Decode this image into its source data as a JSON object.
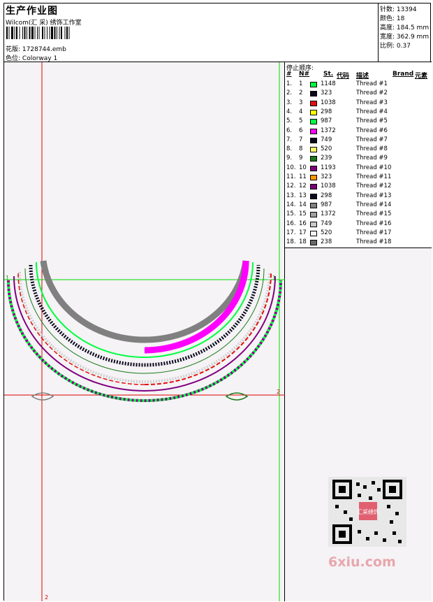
{
  "header": {
    "title": "生产作业图",
    "company": "Wilcom(汇 采) 绣饰工作室",
    "design_label": "花版:",
    "design_value": "1728744.emb",
    "colorway_label": "色位:",
    "colorway_value": "Colorway 1"
  },
  "specs": [
    {
      "label": "针数:",
      "value": "13394"
    },
    {
      "label": "颜色:",
      "value": "18"
    },
    {
      "label": "高度:",
      "value": "184.5 mm"
    },
    {
      "label": "宽度:",
      "value": "362.9 mm"
    },
    {
      "label": "比例:",
      "value": "0.37"
    }
  ],
  "canvas": {
    "marker_top_left": "1",
    "marker_top_right": "1",
    "marker_mid_right": "2",
    "marker_bottom": "2"
  },
  "stop_sequence": {
    "title": "停止顺序:",
    "headers": {
      "idx": "#",
      "no": "N#",
      "st": "St.",
      "code": "代码",
      "desc": "描述",
      "brand": "Brand",
      "elem": "元素"
    },
    "rows": [
      {
        "idx": "1.",
        "no": "1",
        "color": "#00ff40",
        "st": "1148",
        "desc": "Thread #1"
      },
      {
        "idx": "2.",
        "no": "2",
        "color": "#0a0a1e",
        "st": "323",
        "desc": "Thread #2"
      },
      {
        "idx": "3.",
        "no": "3",
        "color": "#e01010",
        "st": "1038",
        "desc": "Thread #3"
      },
      {
        "idx": "4.",
        "no": "4",
        "color": "#ffff00",
        "st": "298",
        "desc": "Thread #4"
      },
      {
        "idx": "5.",
        "no": "5",
        "color": "#00ff40",
        "st": "987",
        "desc": "Thread #5"
      },
      {
        "idx": "6.",
        "no": "6",
        "color": "#ff00ff",
        "st": "1372",
        "desc": "Thread #6"
      },
      {
        "idx": "7.",
        "no": "7",
        "color": "#0a0a1e",
        "st": "749",
        "desc": "Thread #7"
      },
      {
        "idx": "8.",
        "no": "8",
        "color": "#ffff66",
        "st": "520",
        "desc": "Thread #8"
      },
      {
        "idx": "9.",
        "no": "9",
        "color": "#1a7a1a",
        "st": "239",
        "desc": "Thread #9"
      },
      {
        "idx": "10.",
        "no": "10",
        "color": "#800080",
        "st": "1193",
        "desc": "Thread #10"
      },
      {
        "idx": "11.",
        "no": "11",
        "color": "#ff9900",
        "st": "323",
        "desc": "Thread #11"
      },
      {
        "idx": "12.",
        "no": "12",
        "color": "#7a007a",
        "st": "1038",
        "desc": "Thread #12"
      },
      {
        "idx": "13.",
        "no": "13",
        "color": "#0a0a1e",
        "st": "298",
        "desc": "Thread #13"
      },
      {
        "idx": "14.",
        "no": "14",
        "color": "#808080",
        "st": "987",
        "desc": "Thread #14"
      },
      {
        "idx": "15.",
        "no": "15",
        "color": "#a0a0a0",
        "st": "1372",
        "desc": "Thread #15"
      },
      {
        "idx": "16.",
        "no": "16",
        "color": "#c8c8c8",
        "st": "749",
        "desc": "Thread #16"
      },
      {
        "idx": "17.",
        "no": "17",
        "color": "#f4f4f4",
        "st": "520",
        "desc": "Thread #17"
      },
      {
        "idx": "18.",
        "no": "18",
        "color": "#6a6a6a",
        "st": "238",
        "desc": "Thread #18"
      }
    ]
  },
  "watermark": {
    "text": "6xiu.com",
    "qr_stamp_text": "汇采绣饰"
  }
}
